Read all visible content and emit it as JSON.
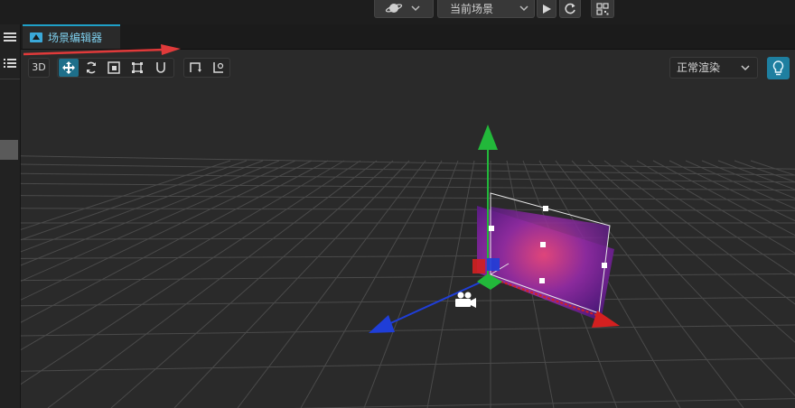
{
  "top_toolbar": {
    "scene_select": "当前场景",
    "icons": [
      "planet-icon",
      "chevron-down-icon",
      "play-icon",
      "refresh-icon",
      "qr-code-icon"
    ]
  },
  "left_strip": {
    "icons": [
      "hamburger-menu-icon",
      "list-icon"
    ]
  },
  "tab": {
    "label": "场景编辑器",
    "icon": "scene-editor-icon",
    "accent": "#1fa0c8"
  },
  "toolbar": {
    "mode_3d": "3D",
    "tools": [
      "move-tool-icon",
      "rotate-tool-icon",
      "scale-tool-icon",
      "rect-tool-icon",
      "magnet-icon"
    ],
    "active_tool": "move-tool-icon",
    "extra_tools": [
      "pivot-icon",
      "local-global-icon"
    ],
    "render_mode": "正常渲染",
    "light_toggle_icon": "light-bulb-icon"
  },
  "annotation_arrow": {
    "color": "#e03a3a"
  },
  "gizmo": {
    "x_color": "#d42020",
    "y_color": "#22b83a",
    "z_color": "#1f3ed8"
  }
}
